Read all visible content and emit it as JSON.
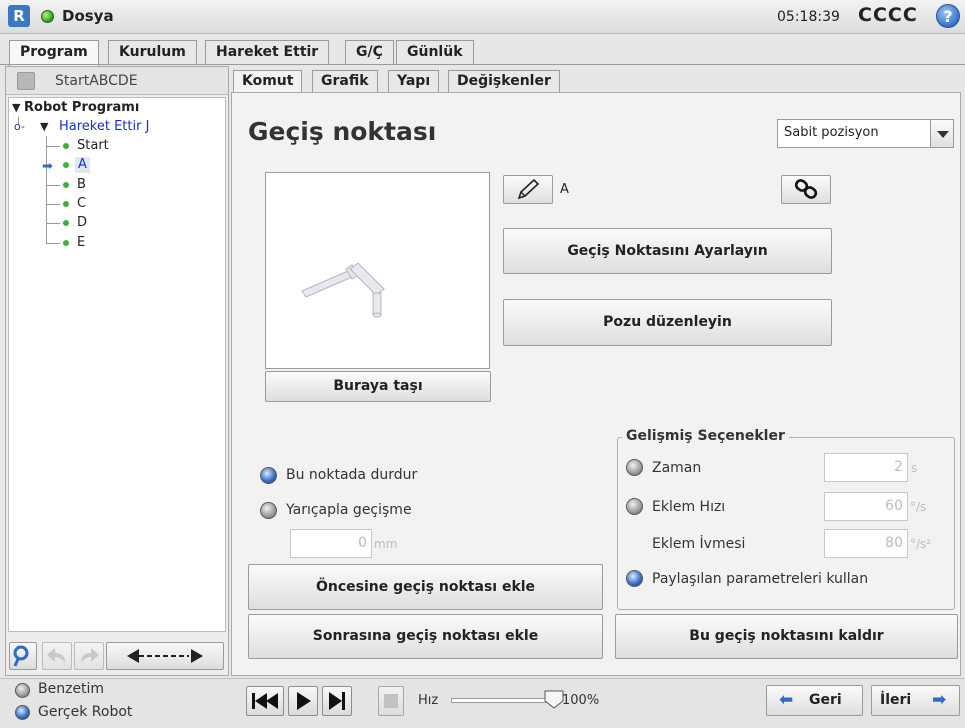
{
  "header": {
    "app_name": "Dosya",
    "time": "05:18:39",
    "robot_name": "CCCC",
    "help": "?"
  },
  "main_tabs": [
    {
      "label": "Program",
      "active": true
    },
    {
      "label": "Kurulum",
      "active": false
    },
    {
      "label": "Hareket Ettir",
      "active": false
    },
    {
      "label": "G/Ç",
      "active": false
    },
    {
      "label": "Günlük",
      "active": false
    }
  ],
  "left": {
    "program_name": "StartABCDE",
    "tree": {
      "root": "Robot Programı",
      "move": "Hareket Ettir J",
      "items": [
        "Start",
        "A",
        "B",
        "C",
        "D",
        "E"
      ],
      "selected": "A"
    }
  },
  "sub_tabs": [
    {
      "label": "Komut",
      "active": true
    },
    {
      "label": "Grafik",
      "active": false
    },
    {
      "label": "Yapı",
      "active": false
    },
    {
      "label": "Değişkenler",
      "active": false
    }
  ],
  "waypoint": {
    "title": "Geçiş noktası",
    "position_type": "Sabit pozisyon",
    "name": "A",
    "set_button": "Geçiş Noktasını Ayarlayın",
    "edit_pose_button": "Pozu düzenleyin",
    "move_here_button": "Buraya taşı",
    "stop_label": "Bu noktada durdur",
    "blend_label": "Yarıçapla geçişme",
    "blend_value": "0",
    "blend_unit": "mm",
    "add_before_button": "Öncesine geçiş noktası ekle",
    "add_after_button": "Sonrasına geçiş noktası ekle",
    "remove_button": "Bu geçiş noktasını kaldır",
    "stop_selected": true
  },
  "advanced": {
    "title": "Gelişmiş Seçenekler",
    "time_label": "Zaman",
    "time_value": "2",
    "time_unit": "s",
    "speed_label": "Eklem Hızı",
    "speed_value": "60",
    "speed_unit": "°/s",
    "accel_label": "Eklem İvmesi",
    "accel_value": "80",
    "accel_unit": "°/s²",
    "shared_label": "Paylaşılan parametreleri kullan"
  },
  "footer": {
    "simulation_label": "Benzetim",
    "real_robot_label": "Gerçek Robot",
    "speed_label": "Hız",
    "speed_value": "100%",
    "speed_fraction": 1.0,
    "back_button": "Geri",
    "next_button": "İleri"
  },
  "colors": {
    "accent_blue": "#2f6cc4",
    "selected_green": "#3db03d",
    "tree_blue": "#1a2fd0"
  }
}
